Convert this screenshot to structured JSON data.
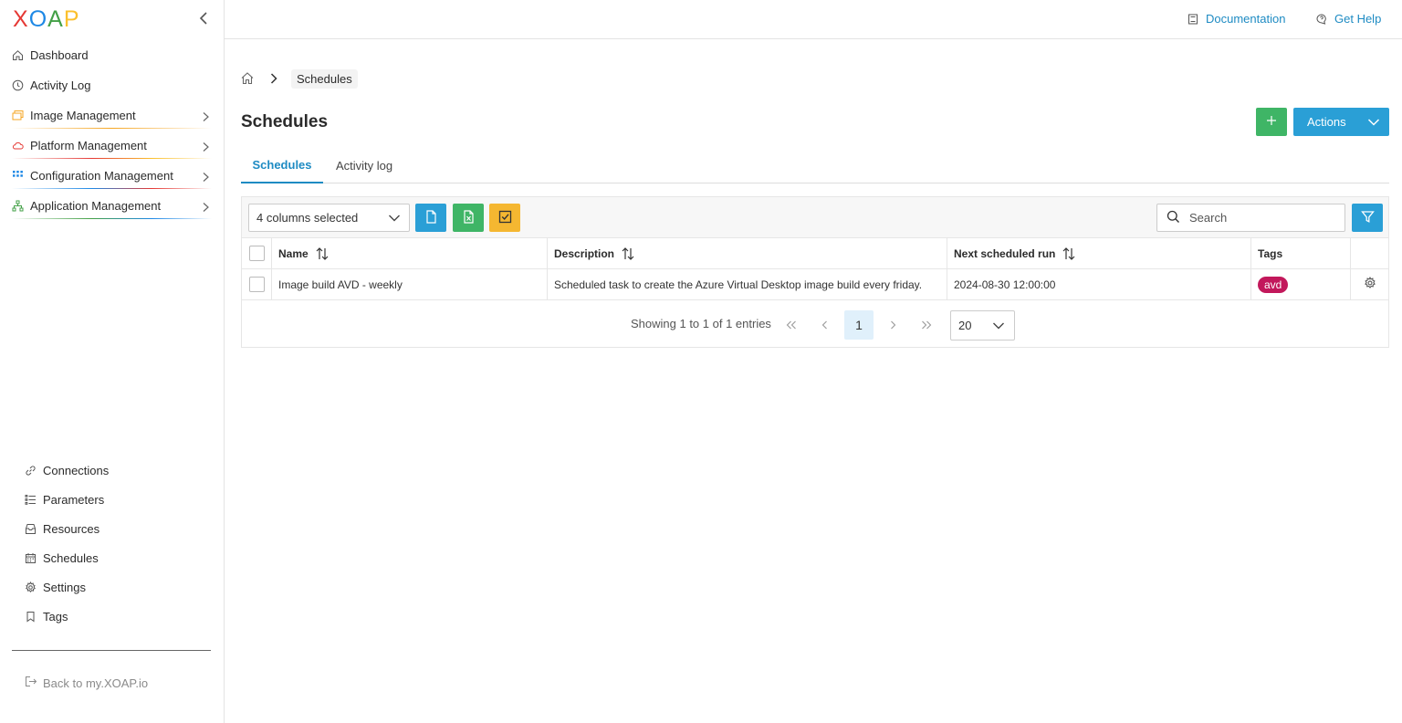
{
  "logo": {
    "letters": [
      "X",
      "O",
      "A",
      "P"
    ],
    "colors": [
      "#e53935",
      "#1e88e5",
      "#43a047",
      "#fbc02d"
    ]
  },
  "sidebar": {
    "items": [
      {
        "label": "Dashboard",
        "icon": "home-icon"
      },
      {
        "label": "Activity Log",
        "icon": "clock-icon"
      },
      {
        "label": "Image Management",
        "icon": "images-icon",
        "accent": "#f5a623"
      },
      {
        "label": "Platform Management",
        "icon": "cloud-icon",
        "accent": "#e53935"
      },
      {
        "label": "Configuration Management",
        "icon": "grid-icon",
        "accent": "#1e88e5"
      },
      {
        "label": "Application Management",
        "icon": "sitemap-icon",
        "accent": "#43a047"
      }
    ],
    "bottom_items": [
      {
        "label": "Connections",
        "icon": "link-icon"
      },
      {
        "label": "Parameters",
        "icon": "list-icon"
      },
      {
        "label": "Resources",
        "icon": "box-icon"
      },
      {
        "label": "Schedules",
        "icon": "calendar-icon"
      },
      {
        "label": "Settings",
        "icon": "gear-icon"
      },
      {
        "label": "Tags",
        "icon": "bookmark-icon"
      }
    ],
    "back_label": "Back to my.XOAP.io"
  },
  "topbar": {
    "documentation": "Documentation",
    "get_help": "Get Help"
  },
  "breadcrumb": {
    "current": "Schedules"
  },
  "page": {
    "title": "Schedules",
    "actions_label": "Actions"
  },
  "tabs": [
    {
      "label": "Schedules",
      "active": true
    },
    {
      "label": "Activity log",
      "active": false
    }
  ],
  "toolbar": {
    "columns_selected": "4 columns selected",
    "search_placeholder": "Search"
  },
  "table": {
    "headers": {
      "name": "Name",
      "description": "Description",
      "next_run": "Next scheduled run",
      "tags": "Tags"
    },
    "rows": [
      {
        "name": "Image build AVD - weekly",
        "description": "Scheduled task to create the Azure Virtual Desktop image build every friday.",
        "next_run": "2024-08-30 12:00:00",
        "tag": "avd"
      }
    ]
  },
  "pagination": {
    "info": "Showing 1 to 1 of 1 entries",
    "current_page": "1",
    "page_size": "20"
  },
  "colors": {
    "primary": "#2a9fd6",
    "success": "#3fb566",
    "warning": "#f5b731",
    "tag": "#c2185b"
  }
}
